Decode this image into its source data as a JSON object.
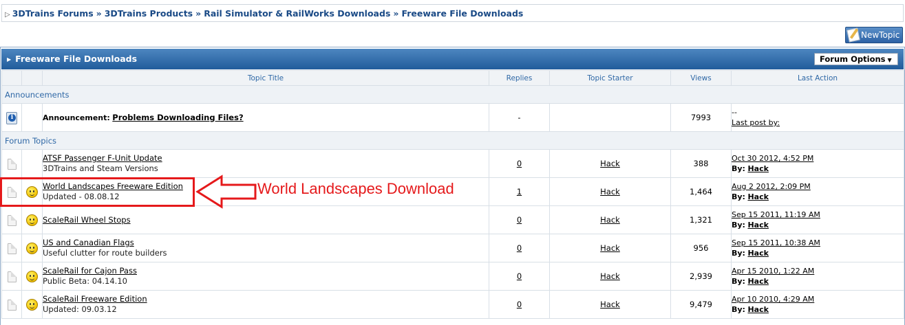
{
  "breadcrumb": {
    "items": [
      "3DTrains Forums",
      "3DTrains Products",
      "Rail Simulator & RailWorks Downloads",
      "Freeware File Downloads"
    ],
    "separator": "»"
  },
  "new_topic_label": "NewTopic",
  "header": {
    "title": "Freeware File Downloads",
    "forum_options_label": "Forum Options"
  },
  "columns": {
    "title": "Topic Title",
    "replies": "Replies",
    "starter": "Topic Starter",
    "views": "Views",
    "last_action": "Last Action"
  },
  "sections": {
    "announcements": "Announcements",
    "forum_topics": "Forum Topics"
  },
  "announcement": {
    "prefix": "Announcement:",
    "title": "Problems Downloading Files?",
    "replies": "-",
    "views": "7993",
    "last_dash": "--",
    "last_post": "Last post by:"
  },
  "topics": [
    {
      "title": "ATSF Passenger F-Unit Update",
      "desc": "3DTrains and Steam Versions",
      "replies": "0",
      "starter": "Hack",
      "views": "388",
      "date": "Oct 30 2012, 4:52 PM",
      "by_label": "By:",
      "by": "Hack"
    },
    {
      "title": "World Landscapes Freeware Edition",
      "desc": "Updated - 08.08.12",
      "replies": "1",
      "starter": "Hack",
      "views": "1,464",
      "date": "Aug 2 2012, 2:09 PM",
      "by_label": "By:",
      "by": "Hack"
    },
    {
      "title": "ScaleRail Wheel Stops",
      "desc": "",
      "replies": "0",
      "starter": "Hack",
      "views": "1,321",
      "date": "Sep 15 2011, 11:19 AM",
      "by_label": "By:",
      "by": "Hack"
    },
    {
      "title": "US and Canadian Flags",
      "desc": "Useful clutter for route builders",
      "replies": "0",
      "starter": "Hack",
      "views": "956",
      "date": "Sep 15 2011, 10:38 AM",
      "by_label": "By:",
      "by": "Hack"
    },
    {
      "title": "ScaleRail for Cajon Pass",
      "desc": "Public Beta: 04.14.10",
      "replies": "0",
      "starter": "Hack",
      "views": "2,939",
      "date": "Apr 15 2010, 1:22 AM",
      "by_label": "By:",
      "by": "Hack"
    },
    {
      "title": "ScaleRail Freeware Edition",
      "desc": "Updated: 09.03.12",
      "replies": "0",
      "starter": "Hack",
      "views": "9,479",
      "date": "Apr 10 2010, 4:29 AM",
      "by_label": "By:",
      "by": "Hack"
    }
  ],
  "topic_icons": [
    "doc-icon",
    "smiley-icon"
  ],
  "annotation": {
    "text": "World Landscapes Download",
    "color": "#e5191b"
  },
  "colors": {
    "header_bg": "#2f6aa8",
    "link": "#1a4a86",
    "column_text": "#2f68a6"
  }
}
